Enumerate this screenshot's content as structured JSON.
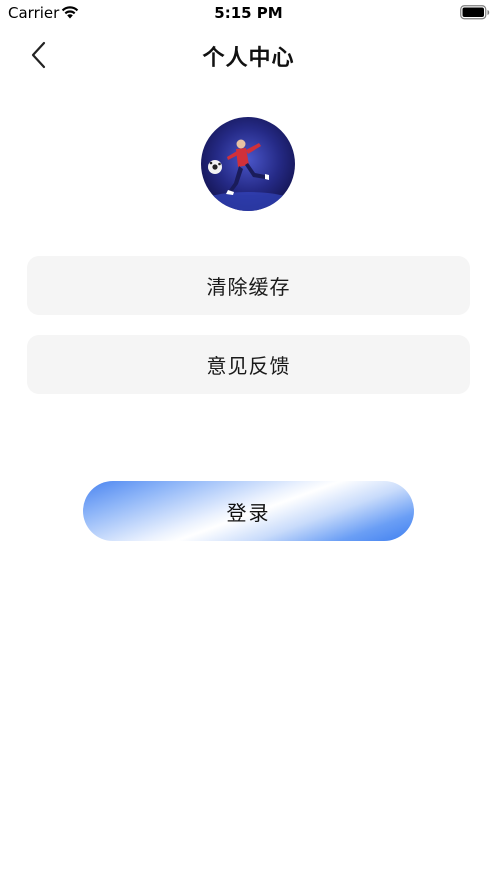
{
  "status_bar": {
    "carrier": "Carrier",
    "time": "5:15 PM",
    "wifi_icon": "wifi-icon",
    "battery_icon": "battery-icon"
  },
  "nav": {
    "back_icon": "chevron-left-icon",
    "title": "个人中心"
  },
  "avatar": {
    "description_icon": "avatar-image"
  },
  "menu": {
    "items": [
      {
        "label": "清除缓存"
      },
      {
        "label": "意见反馈"
      }
    ]
  },
  "login": {
    "label": "登录"
  },
  "colors": {
    "card_background": "#f5f5f5",
    "login_gradient_start": "#4a84f0",
    "login_gradient_mid": "#ffffff",
    "login_gradient_end": "#3f7ff0",
    "avatar_background": "#1c1f6e"
  }
}
